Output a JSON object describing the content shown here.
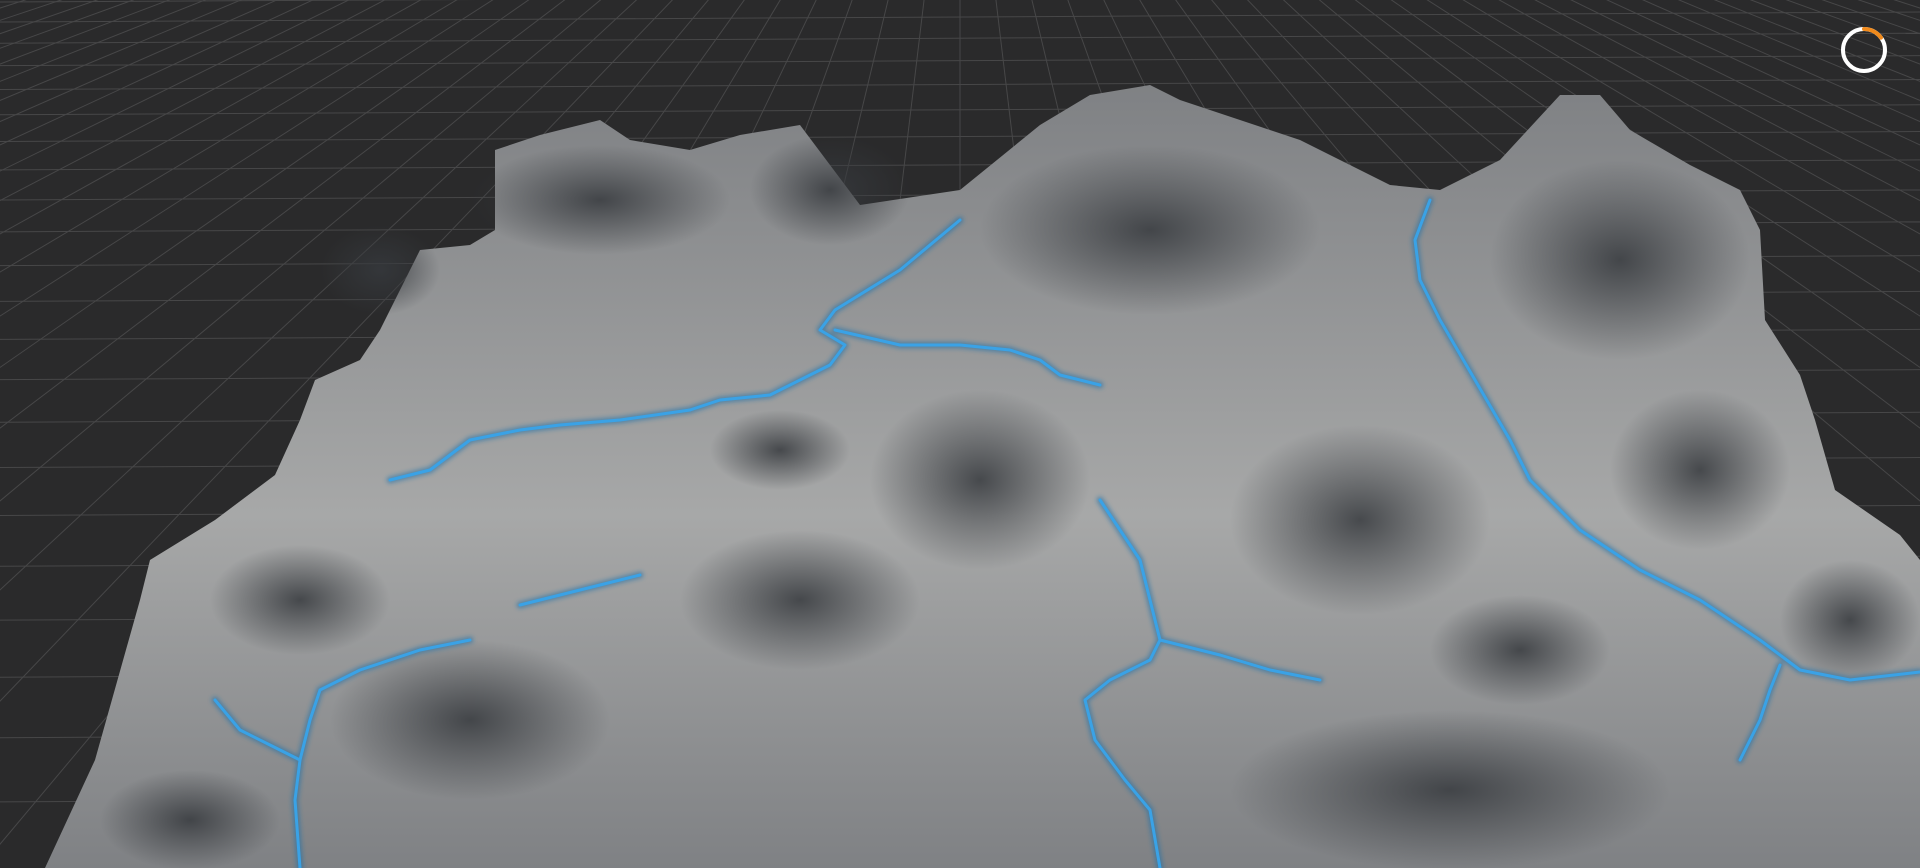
{
  "viewport": {
    "background_color": "#2a2a2b",
    "grid_color": "#474748",
    "terrain_light_color": "#a7a8a8",
    "terrain_mid_color": "#7f8184",
    "terrain_shadow_color": "#36393d",
    "river_color": "#3aa2e6",
    "river_glow_color": "#1f6fa8"
  },
  "loading_indicator": {
    "icon": "loading-spinner-icon",
    "ring_color": "#ffffff",
    "accent_color": "#f08a1c",
    "progress": 0.15
  }
}
